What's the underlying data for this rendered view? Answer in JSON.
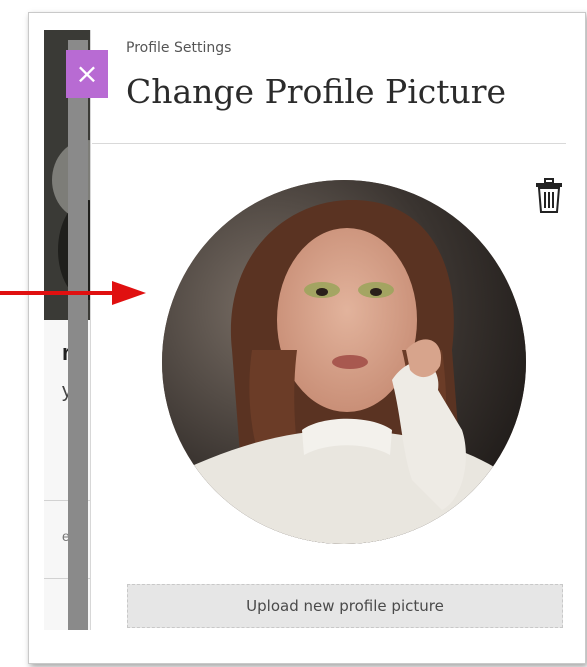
{
  "panel": {
    "kicker": "Profile Settings",
    "title": "Change Profile Picture",
    "close_glyph": "×",
    "upload_label": "Upload new profile picture"
  },
  "background_page": {
    "fragment_1": "r",
    "fragment_2": "y",
    "fragment_3": "er"
  },
  "icons": {
    "close": "close-icon",
    "delete": "trash-icon"
  },
  "colors": {
    "close_button": "#b86bd3",
    "annotation_arrow": "#e01010"
  }
}
